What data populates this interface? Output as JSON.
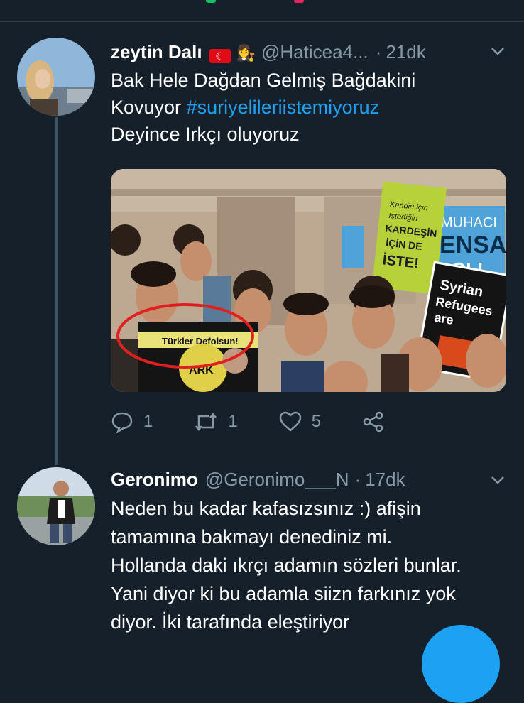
{
  "tweet1": {
    "name": "zeytin Dalı",
    "flag_emoji": "🇹🇷",
    "badge_emoji": "👩‍⚖️",
    "handle": "@Haticea4...",
    "separator": "·",
    "time": "21dk",
    "text_line1": "Bak Hele Dağdan Gelmiş Bağdakini",
    "text_line2_plain": "Kovuyor ",
    "hashtag": "#suriyelileriistemiyoruz",
    "text_line3": "Deyince Irkçı oluyoruz",
    "media": {
      "sign_green": [
        "Kendin için",
        "İstediğin",
        "KARDEŞİN",
        "İÇİN DE",
        "İSTE!"
      ],
      "sign_blue": [
        "MUHACI",
        "ENSA",
        "OL!"
      ],
      "sign_black": [
        "Syrian",
        "Refugees",
        "are"
      ],
      "sign_circled": "Türkler Defolsun!",
      "sign_circled_sub": "ARK"
    },
    "reply_count": "1",
    "retweet_count": "1",
    "like_count": "5"
  },
  "tweet2": {
    "name": "Geronimo",
    "handle": "@Geronimo___N",
    "separator": "·",
    "time": "17dk",
    "text_lines": [
      "Neden bu kadar kafasızsınız :) afişin",
      "tamamına bakmayı denediniz mi.",
      "Hollanda daki ıkrçı adamın sözleri bunlar.",
      "Yani diyor ki bu adamla siizn farkınız yok",
      "diyor. İki tarafında eleştiriyor"
    ]
  },
  "colors": {
    "background": "#15202b",
    "secondary_text": "#8899a6",
    "accent": "#1da1f2"
  },
  "icons": [
    "reply-icon",
    "retweet-icon",
    "like-icon",
    "share-icon",
    "chevron-down-icon"
  ]
}
